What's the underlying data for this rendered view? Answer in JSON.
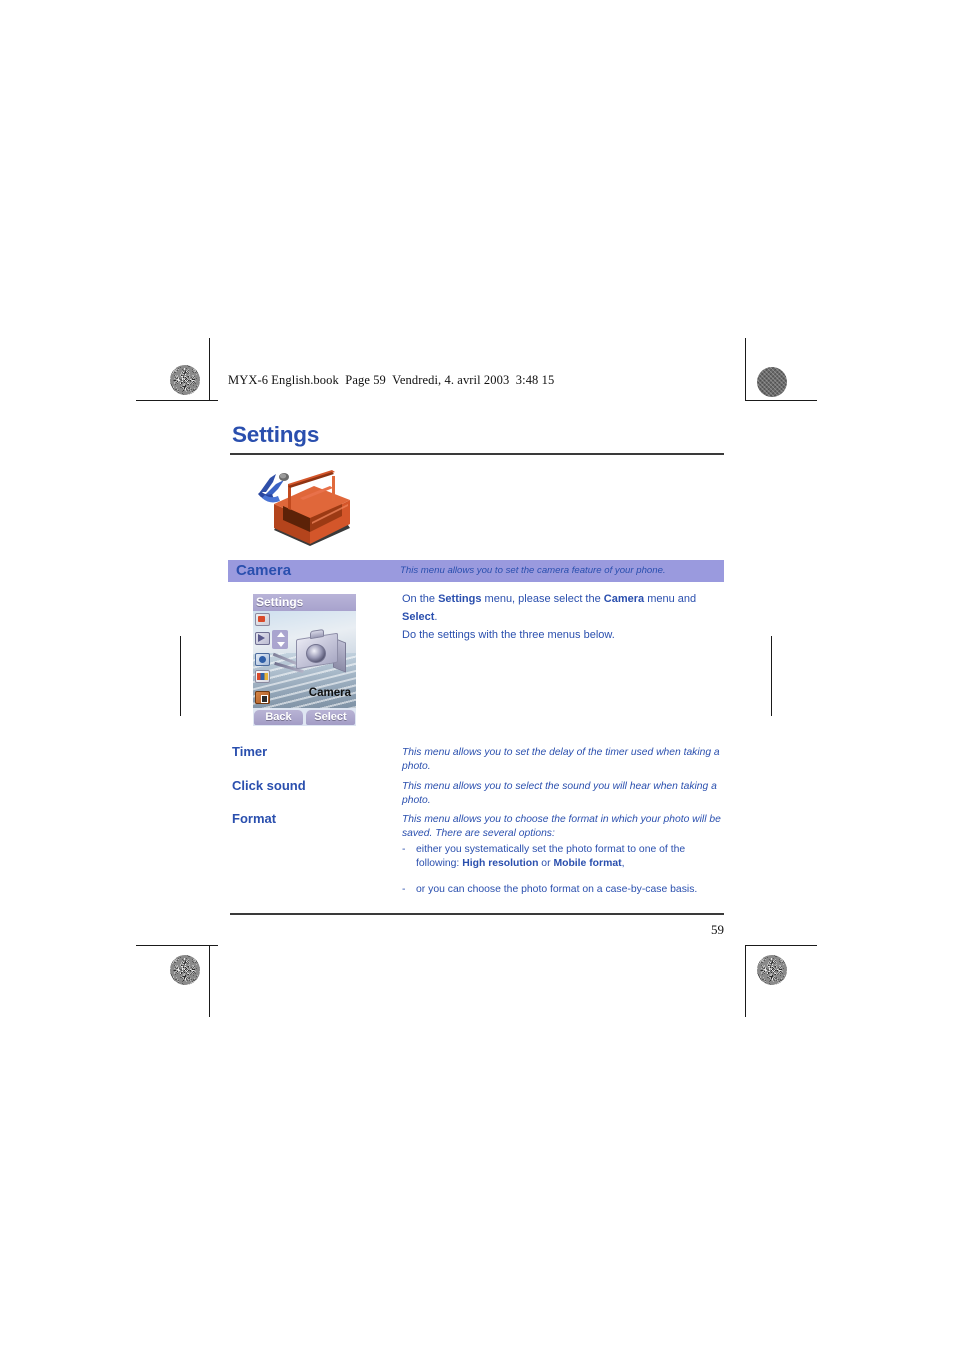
{
  "document": {
    "file_header": "MYX-6 English.book  Page 59  Vendredi, 4. avril 2003  3:48 15",
    "chapter_title": "Settings",
    "page_number": "59",
    "chapter_illustration_icon": "toolbox-with-pliers-icon"
  },
  "camera_section": {
    "title": "Camera",
    "description": "This menu allows you to set the camera feature of your phone.",
    "banner_color": "#9a9ade",
    "heading_color": "#2a4fae",
    "intro_paragraph": {
      "line1_part1": "On the ",
      "line1_bold1": "Settings",
      "line1_part2": " menu, please select the ",
      "line1_bold2": "Camera",
      "line1_part3": " menu and ",
      "line1_bold3": "Select",
      "line1_part4": ".",
      "line2": "Do the settings with the three menus below."
    }
  },
  "phone_mockup": {
    "title_bar": "Settings",
    "selected_item_label": "Camera",
    "softkey_left": "Back",
    "softkey_right": "Select",
    "icons": [
      "messages-icon",
      "tools-icon",
      "network-icon",
      "display-icon",
      "security-lock-icon"
    ],
    "main_graphic": "digital-camera-icon"
  },
  "settings_rows": [
    {
      "label": "Timer",
      "description": "This menu allows you to set the delay of the timer used when taking a photo."
    },
    {
      "label": "Click sound",
      "description": "This menu allows you to select the sound you will hear when taking a photo."
    },
    {
      "label": "Format",
      "description": "This menu allows you to choose the format in which your photo will be saved. There are several options:"
    }
  ],
  "format_bullets": [
    {
      "dash": "-",
      "part1": "either you systematically set the photo format to one of the following: ",
      "bold1": "High resolution",
      "part2": " or ",
      "bold2": "Mobile format",
      "part3": ","
    },
    {
      "dash": "-",
      "part1": "or you can choose the photo format on a case-by-case basis.",
      "bold1": "",
      "part2": "",
      "bold2": "",
      "part3": ""
    }
  ]
}
